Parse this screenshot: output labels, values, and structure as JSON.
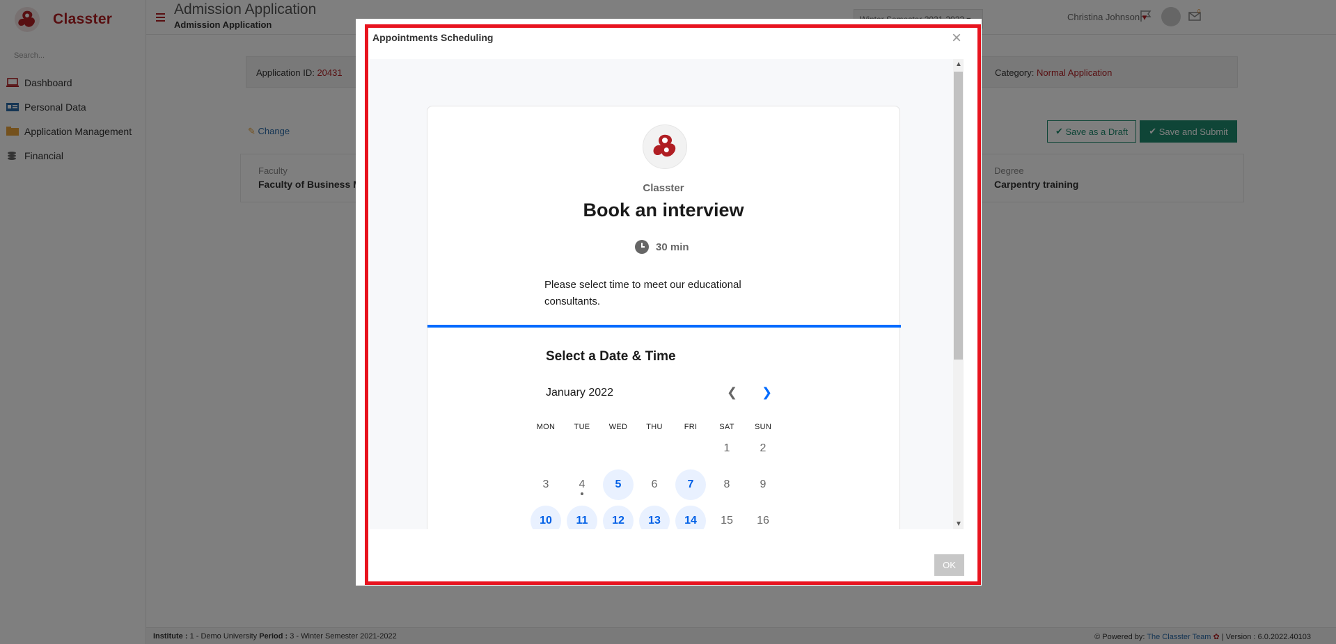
{
  "app": {
    "name": "Classter",
    "accent": "#b01e23"
  },
  "sidebar": {
    "search_placeholder": "Search...",
    "items": [
      {
        "label": "Dashboard",
        "icon": "laptop-icon"
      },
      {
        "label": "Personal Data",
        "icon": "id-card-icon"
      },
      {
        "label": "Application Management",
        "icon": "folder-icon"
      },
      {
        "label": "Financial",
        "icon": "coins-icon"
      }
    ]
  },
  "header": {
    "title": "Admission Application",
    "subtitle": "Admission Application",
    "semester": "Winter Semester 2021-2022",
    "notifications_count": "0",
    "messages_count": "0",
    "user": "Christina Johnson"
  },
  "application": {
    "id_label": "Application ID:",
    "id_value": "20431",
    "category_label": "Category:",
    "category_value": "Normal Application",
    "change_label": "Change",
    "save_draft_label": "Save as a Draft",
    "save_submit_label": "Save and Submit",
    "faculty_label": "Faculty",
    "faculty_value": "Faculty of Business M",
    "degree_label": "Degree",
    "degree_value": "Carpentry training"
  },
  "footer": {
    "institute_label": "Institute :",
    "institute_value": "1 - Demo University",
    "period_label": "Period :",
    "period_value": "3 - Winter Semester 2021-2022",
    "powered_by": "Powered by:",
    "powered_link": "The Classter Team",
    "version": "| Version : 6.0.2022.40103"
  },
  "modal": {
    "title": "Appointments Scheduling",
    "close": "×",
    "ok_label": "OK"
  },
  "booking": {
    "organizer": "Classter",
    "event_name": "Book an interview",
    "duration": "30 min",
    "description": "Please select time to meet our educational consultants.",
    "section_title": "Select a Date & Time",
    "month": "January 2022",
    "weekdays": [
      "MON",
      "TUE",
      "WED",
      "THU",
      "FRI",
      "SAT",
      "SUN"
    ],
    "days": [
      {
        "n": "1",
        "avail": false
      },
      {
        "n": "2",
        "avail": false
      },
      {
        "n": "3",
        "avail": false
      },
      {
        "n": "4",
        "avail": false,
        "today": true
      },
      {
        "n": "5",
        "avail": true
      },
      {
        "n": "6",
        "avail": false
      },
      {
        "n": "7",
        "avail": true
      },
      {
        "n": "8",
        "avail": false
      },
      {
        "n": "9",
        "avail": false
      },
      {
        "n": "10",
        "avail": true
      },
      {
        "n": "11",
        "avail": true
      },
      {
        "n": "12",
        "avail": true
      },
      {
        "n": "13",
        "avail": true
      },
      {
        "n": "14",
        "avail": true
      },
      {
        "n": "15",
        "avail": false
      },
      {
        "n": "16",
        "avail": false
      }
    ],
    "accent": "#006bff"
  }
}
